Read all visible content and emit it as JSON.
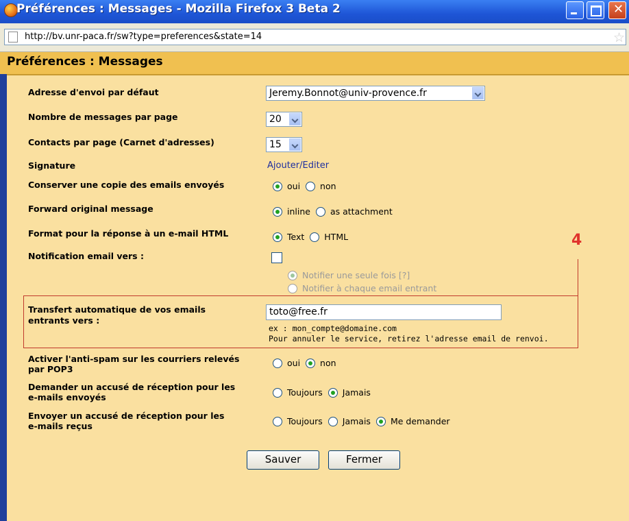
{
  "window": {
    "title": "Préférences : Messages - Mozilla Firefox 3 Beta 2",
    "url": "http://bv.unr-paca.fr/sw?type=preferences&state=14"
  },
  "page": {
    "title": "Préférences : Messages"
  },
  "form": {
    "default_address": {
      "label": "Adresse d'envoi par défaut",
      "value": "Jeremy.Bonnot@univ-provence.fr"
    },
    "messages_per_page": {
      "label": "Nombre de messages par page",
      "value": "20"
    },
    "contacts_per_page": {
      "label": "Contacts par page (Carnet d'adresses)",
      "value": "15"
    },
    "signature": {
      "label": "Signature",
      "link": "Ajouter/Editer"
    },
    "keep_copy": {
      "label": "Conserver une copie des emails envoyés",
      "options": [
        "oui",
        "non"
      ],
      "selected": "oui"
    },
    "forward_original": {
      "label": "Forward original message",
      "options": [
        "inline",
        "as attachment"
      ],
      "selected": "inline"
    },
    "reply_format": {
      "label": "Format pour la réponse à un e-mail HTML",
      "options": [
        "Text",
        "HTML"
      ],
      "selected": "Text"
    },
    "notification": {
      "label": "Notification email vers :",
      "checked": false,
      "options": [
        "Notifier une seule fois [?]",
        "Notifier à chaque email entrant"
      ],
      "selected": "Notifier une seule fois [?]"
    },
    "auto_forward": {
      "label_line1": "Transfert automatique de vos emails",
      "label_line2": "entrants vers :",
      "value": "toto@free.fr",
      "hint_example": "ex : mon_compte@domaine.com",
      "hint_cancel": "Pour annuler le service, retirez l'adresse email de renvoi."
    },
    "antispam": {
      "label_line1": "Activer l'anti-spam sur les courriers relevés",
      "label_line2": "par POP3",
      "options": [
        "oui",
        "non"
      ],
      "selected": "non"
    },
    "request_receipt": {
      "label_line1": "Demander un accusé de réception pour les",
      "label_line2": "e-mails envoyés",
      "options": [
        "Toujours",
        "Jamais"
      ],
      "selected": "Jamais"
    },
    "send_receipt": {
      "label_line1": "Envoyer un accusé de réception pour les",
      "label_line2": "e-mails reçus",
      "options": [
        "Toujours",
        "Jamais",
        "Me demander"
      ],
      "selected": "Me demander"
    }
  },
  "buttons": {
    "save": "Sauver",
    "close": "Fermer"
  },
  "annotation": {
    "marker": "4",
    "color": "#e0332c"
  },
  "colors": {
    "background": "#fae0a0",
    "header": "#f0c050",
    "link": "#1f2f9f",
    "titlebar": "#1e55d6"
  }
}
